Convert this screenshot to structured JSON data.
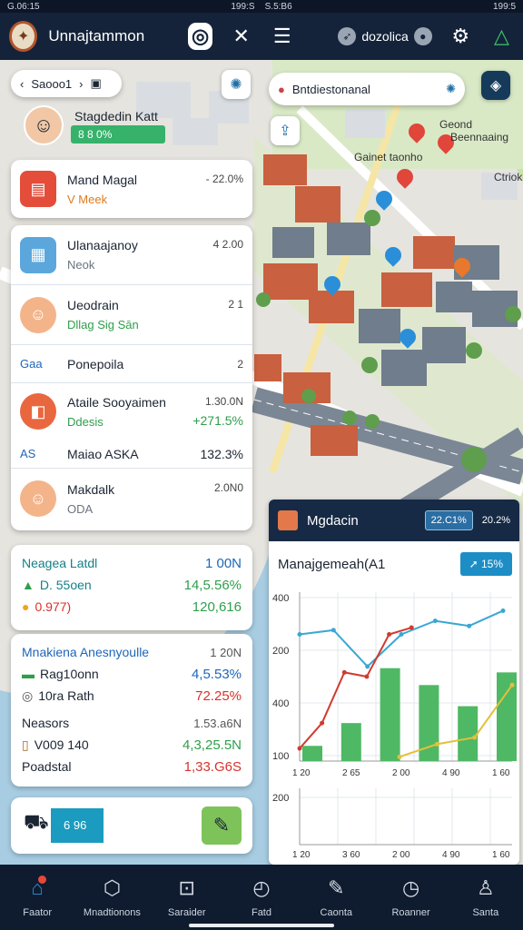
{
  "status": {
    "left": "G.06:15",
    "center1": "199:S",
    "center2": "S.5:B6",
    "right": "199:5"
  },
  "header": {
    "title": "Unnajtammon",
    "logo_icon": "shield-logo-icon",
    "location_text": "dozolica"
  },
  "map": {
    "search_chip": "Saooo1",
    "location_search": "Bntdiestonanal",
    "labels": [
      "Geond",
      "Beennaaing",
      "Gainet taonho",
      "Ctriok"
    ]
  },
  "profile": {
    "name": "Stagdedin Katt",
    "percent": "8 8 0%"
  },
  "list": [
    {
      "title": "Mand Magal",
      "sub": "V Meek",
      "value": "- 22.0%",
      "value2": "",
      "sub_color": "orange"
    },
    {
      "title": "Ulanaajanoy",
      "sub": "Neok",
      "value": "4 2.00",
      "value2": "",
      "sub_color": "gray"
    },
    {
      "title": "Ueodrain",
      "sub": "Dllag Sig Sān",
      "value": "2 1",
      "value2": "",
      "sub_color": "green"
    },
    {
      "title": "Ponepoila",
      "sub": "",
      "value": "2",
      "value2": "",
      "sub_color": "gray",
      "prefix": "Gaa"
    },
    {
      "title": "Ataile Sooyaimen",
      "sub": "Ddesis",
      "value": "1.30.0N",
      "value2": "+271.5%",
      "sub_color": "green"
    },
    {
      "title": "Maiao ASKA",
      "sub": "",
      "value": "132.3%",
      "value2": "",
      "sub_color": "gray",
      "prefix": "AS"
    },
    {
      "title": "Makdalk",
      "sub": "ODA",
      "value": "2.0N0",
      "value2": "",
      "sub_color": "gray"
    }
  ],
  "card1": {
    "rows": [
      {
        "label": "Neagea Latdl",
        "value": "1 00N",
        "lcolor": "teal",
        "vcolor": "blue"
      },
      {
        "label": "D. 55oen",
        "value": "14,5.56%",
        "lcolor": "teal",
        "vcolor": "green"
      },
      {
        "label": "0.977)",
        "value": "120,616",
        "lcolor": "red",
        "vcolor": "green"
      }
    ]
  },
  "card2": {
    "rows": [
      {
        "label": "Mnakiena Anesnyoulle",
        "value": "1 20N",
        "lcolor": "blue",
        "vcolor": "gray"
      },
      {
        "label": "Rag10onn",
        "value": "4,5.53%",
        "lcolor": "dark",
        "vcolor": "blue"
      },
      {
        "label": "10ra Rath",
        "value": "72.25%",
        "lcolor": "dark",
        "vcolor": "red"
      },
      {
        "label": "Neasors",
        "value": "1.53.a6N",
        "lcolor": "dark",
        "vcolor": "gray"
      },
      {
        "label": "V009 140",
        "value": "4,3,25.5N",
        "lcolor": "dark",
        "vcolor": "green"
      },
      {
        "label": "Poadstal",
        "value": "1,33.G6S",
        "lcolor": "dark",
        "vcolor": "red"
      }
    ]
  },
  "bottom_card": {
    "value": "6 96"
  },
  "chart_panel": {
    "title": "Mgdacin",
    "pill1": "22.C1%",
    "pill2": "20.2%",
    "subtitle": "Manajgemeah(A1",
    "badge": "15%"
  },
  "chart_data": [
    {
      "type": "bar",
      "yticks": [
        "400",
        "200",
        "400",
        "100"
      ],
      "xticks": [
        "1 20",
        "2 65",
        "2 00",
        "4 90",
        "1 60"
      ],
      "values": [
        18,
        45,
        110,
        90,
        65,
        105
      ],
      "ylim": [
        0,
        200
      ],
      "series": [
        {
          "color": "#3aa7d4",
          "values": [
            150,
            155,
            112,
            150,
            166,
            160,
            178
          ]
        },
        {
          "color": "#d13a2f",
          "values": [
            15,
            45,
            105,
            100,
            150,
            158
          ]
        },
        {
          "color": "#e0c13a",
          "values": [
            5,
            20,
            28,
            90
          ]
        }
      ]
    },
    {
      "type": "line",
      "yticks": [
        "200"
      ],
      "xticks": [
        "1 20",
        "3 60",
        "2 00",
        "4 90",
        "1 60"
      ]
    }
  ],
  "tabs": [
    {
      "label": "Faator",
      "icon": "home-icon",
      "active": true
    },
    {
      "label": "Mnadtionons",
      "icon": "hexagon-icon"
    },
    {
      "label": "Saraider",
      "icon": "inbox-icon"
    },
    {
      "label": "Fatd",
      "icon": "compass-icon"
    },
    {
      "label": "Caonta",
      "icon": "pen-icon"
    },
    {
      "label": "Roanner",
      "icon": "clock-icon"
    },
    {
      "label": "Santa",
      "icon": "user-icon"
    }
  ],
  "colors": {
    "accent": "#2b8fd6",
    "header": "#14233a",
    "green": "#36b26b",
    "red": "#d8322b"
  }
}
